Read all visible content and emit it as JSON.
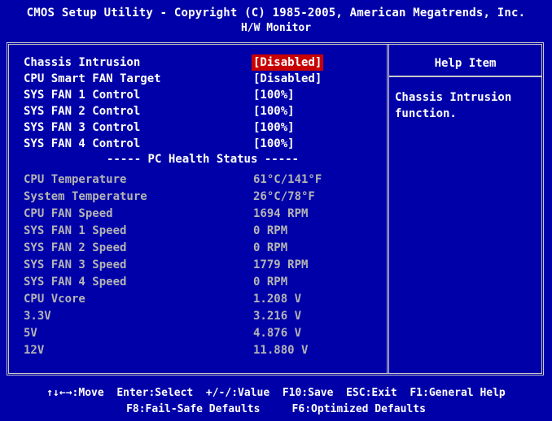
{
  "header": {
    "title": "CMOS Setup Utility - Copyright (C) 1985-2005, American Megatrends, Inc.",
    "subtitle": "H/W Monitor"
  },
  "settings": [
    {
      "label": "Chassis Intrusion",
      "value": "[Disabled]"
    },
    {
      "label": "CPU Smart FAN Target",
      "value": "[Disabled]"
    },
    {
      "label": "SYS FAN 1 Control",
      "value": "[100%]"
    },
    {
      "label": "SYS FAN 2 Control",
      "value": "[100%]"
    },
    {
      "label": "SYS FAN 3 Control",
      "value": "[100%]"
    },
    {
      "label": "SYS FAN 4 Control",
      "value": "[100%]"
    }
  ],
  "health_header": "----- PC Health Status -----",
  "health": [
    {
      "label": "CPU Temperature",
      "value": "61°C/141°F"
    },
    {
      "label": "System Temperature",
      "value": "26°C/78°F"
    },
    {
      "label": "CPU FAN Speed",
      "value": "1694 RPM"
    },
    {
      "label": "SYS FAN 1 Speed",
      "value": "0 RPM"
    },
    {
      "label": "SYS FAN 2 Speed",
      "value": "0 RPM"
    },
    {
      "label": "SYS FAN 3 Speed",
      "value": "1779 RPM"
    },
    {
      "label": "SYS FAN 4 Speed",
      "value": "0 RPM"
    },
    {
      "label": "CPU Vcore",
      "value": "1.208 V"
    },
    {
      "label": "3.3V",
      "value": "3.216 V"
    },
    {
      "label": "5V",
      "value": "4.876 V"
    },
    {
      "label": "12V",
      "value": "11.880 V"
    }
  ],
  "help": {
    "title": "Help Item",
    "text": "Chassis Intrusion\nfunction."
  },
  "footer": {
    "line1": "↑↓←→:Move  Enter:Select  +/-/:Value  F10:Save  ESC:Exit  F1:General Help",
    "line2": "F8:Fail-Safe Defaults     F6:Optimized Defaults"
  },
  "colors": {
    "background": "#0000a8",
    "selected": "#c80000",
    "readonly_text": "#b4b4b4"
  }
}
